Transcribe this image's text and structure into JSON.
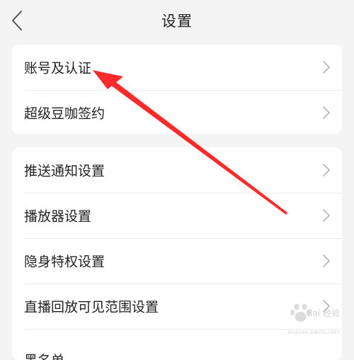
{
  "header": {
    "title": "设置",
    "back_icon": "chevron-left-icon"
  },
  "groups": [
    {
      "items": [
        {
          "label": "账号及认证"
        },
        {
          "label": "超级豆咖签约"
        }
      ]
    },
    {
      "items": [
        {
          "label": "推送通知设置"
        },
        {
          "label": "播放器设置"
        },
        {
          "label": "隐身特权设置"
        },
        {
          "label": "直播回放可见范围设置"
        },
        {
          "label": "黑名单"
        }
      ]
    }
  ],
  "annotation": {
    "type": "red-arrow",
    "color": "#ff2a2a",
    "target": "账号及认证"
  },
  "watermark": {
    "text": "Bai 经验",
    "sub": "jingyan.baidu.com"
  },
  "colors": {
    "background": "#f4f4f4",
    "card": "#ffffff",
    "text": "#222222",
    "chevron": "#b5b5b5"
  }
}
